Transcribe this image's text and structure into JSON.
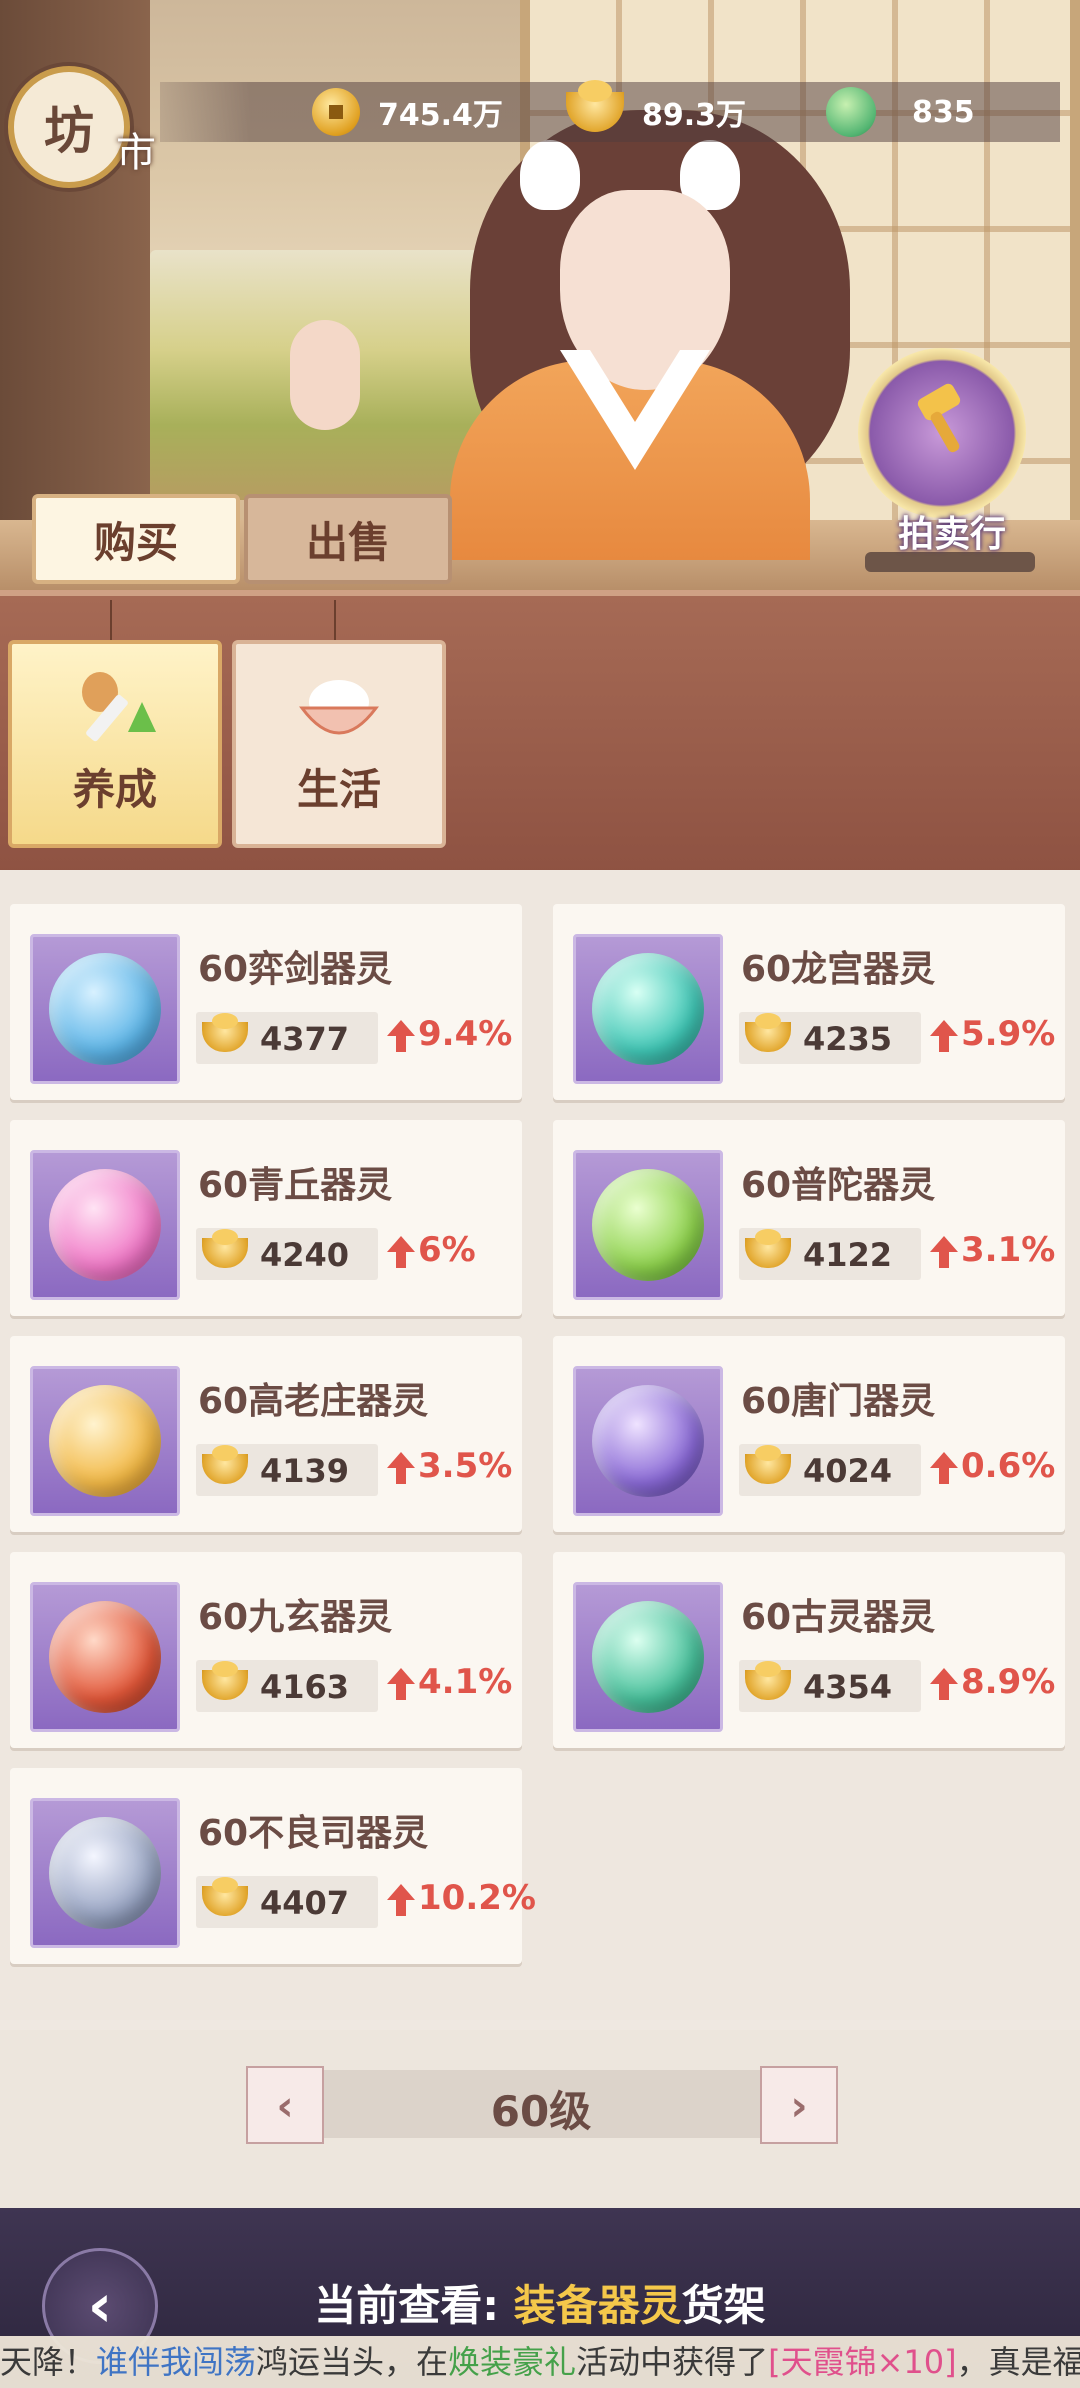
{
  "header": {
    "logo_char1": "坊",
    "logo_char2": "市",
    "resources": [
      {
        "icon": "copper-coin-icon",
        "value": "745.4万"
      },
      {
        "icon": "gold-ingot-icon",
        "value": "89.3万"
      },
      {
        "icon": "jade-icon",
        "value": "835"
      }
    ],
    "auction_label": "拍卖行"
  },
  "tabs": {
    "buy": "购买",
    "sell": "出售"
  },
  "categories": [
    {
      "label": "养成",
      "icon": "sword-upgrade-icon",
      "selected": true
    },
    {
      "label": "生活",
      "icon": "food-bowl-icon",
      "selected": false
    }
  ],
  "items": [
    {
      "name": "60弈剑器灵",
      "price": "4377",
      "change": "9.4%",
      "icon": "sword-spirit-orb-icon",
      "color": "#5fb6e8"
    },
    {
      "name": "60龙宫器灵",
      "price": "4235",
      "change": "5.9%",
      "icon": "dragon-spirit-orb-icon",
      "color": "#41c7b6"
    },
    {
      "name": "60青丘器灵",
      "price": "4240",
      "change": "6%",
      "icon": "fox-flower-spirit-orb-icon",
      "color": "#f07ac7"
    },
    {
      "name": "60普陀器灵",
      "price": "4122",
      "change": "3.1%",
      "icon": "leaf-spirit-orb-icon",
      "color": "#8fd24e"
    },
    {
      "name": "60高老庄器灵",
      "price": "4139",
      "change": "3.5%",
      "icon": "scroll-spirit-orb-icon",
      "color": "#f2b947"
    },
    {
      "name": "60唐门器灵",
      "price": "4024",
      "change": "0.6%",
      "icon": "crossbow-spirit-orb-icon",
      "color": "#8a6ad6"
    },
    {
      "name": "60九玄器灵",
      "price": "4163",
      "change": "4.1%",
      "icon": "umbrella-spirit-orb-icon",
      "color": "#e2583a"
    },
    {
      "name": "60古灵器灵",
      "price": "4354",
      "change": "8.9%",
      "icon": "flute-spirit-orb-icon",
      "color": "#49c19c"
    },
    {
      "name": "60不良司器灵",
      "price": "4407",
      "change": "10.2%",
      "icon": "mask-spirit-orb-icon",
      "color": "#9aa6c4"
    }
  ],
  "pager": {
    "label": "60级",
    "prev": "‹",
    "next": "›"
  },
  "footer": {
    "back": "‹",
    "current_prefix": "当前查看: ",
    "current_highlight": "装备器灵",
    "current_suffix": "货架",
    "ticker": {
      "t1": "天降！",
      "t2": "谁伴我闯荡",
      "t3": "鸿运当头，在",
      "t4": "焕装豪礼",
      "t5": "活动中获得了",
      "t6": "[天霞锦×10]",
      "t7": "，真是福缘不浅"
    }
  },
  "colors": {
    "up_arrow": "#e0554b",
    "accent_brown": "#6b3f2e"
  }
}
